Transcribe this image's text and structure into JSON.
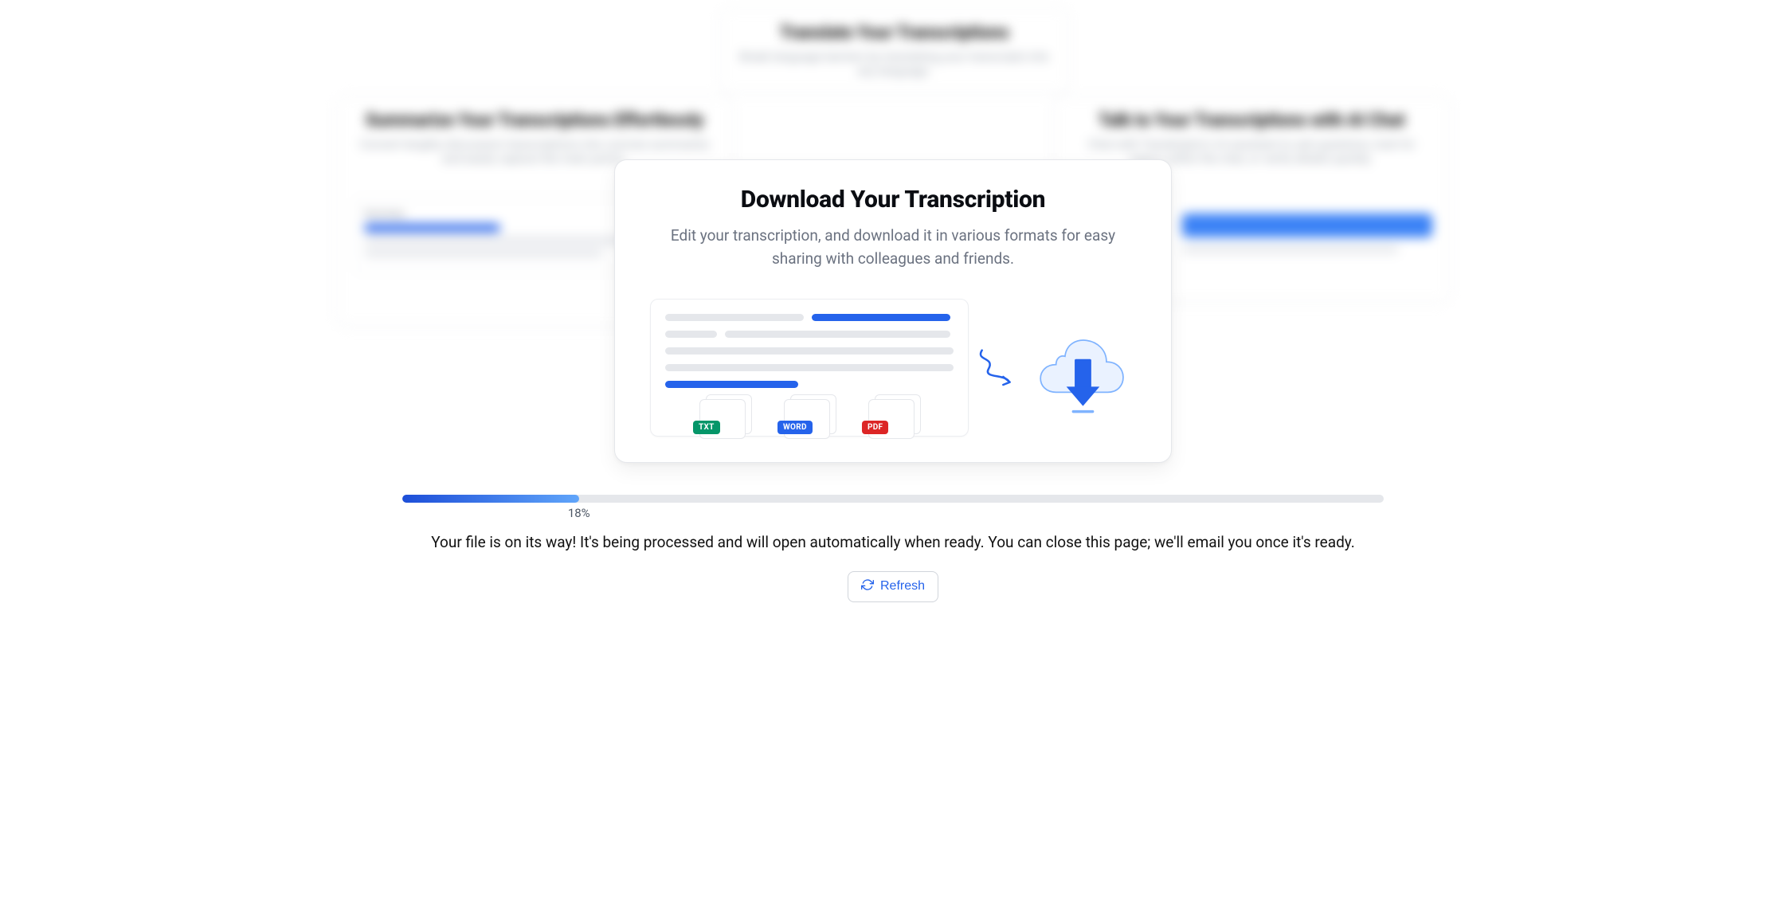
{
  "background": {
    "top": {
      "title": "Translate Your Transcriptions",
      "desc": "Break language barriers by translating your transcripts into any language."
    },
    "left": {
      "title": "Summarize Your Transcriptions Effortlessly",
      "desc": "Convert lengthy discussion transcriptions into concise summaries and easily capture the main points.",
      "box_label": "Summary"
    },
    "right": {
      "title": "Talk to Your Transcriptions with AI Chat",
      "desc": "Chat with Transkriptor's AI assistant to ask questions, look for topics within the chat, or verify details quickly."
    }
  },
  "card": {
    "title": "Download Your Transcription",
    "subtitle": "Edit your transcription, and download it in various formats for easy sharing with colleagues and friends.",
    "formats": {
      "txt": "TXT",
      "word": "WORD",
      "pdf": "PDF"
    }
  },
  "progress": {
    "percent": 18,
    "label": "18%"
  },
  "status": "Your file is on its way! It's being processed and will open automatically when ready. You can close this page; we'll email you once it's ready.",
  "actions": {
    "refresh": "Refresh"
  }
}
